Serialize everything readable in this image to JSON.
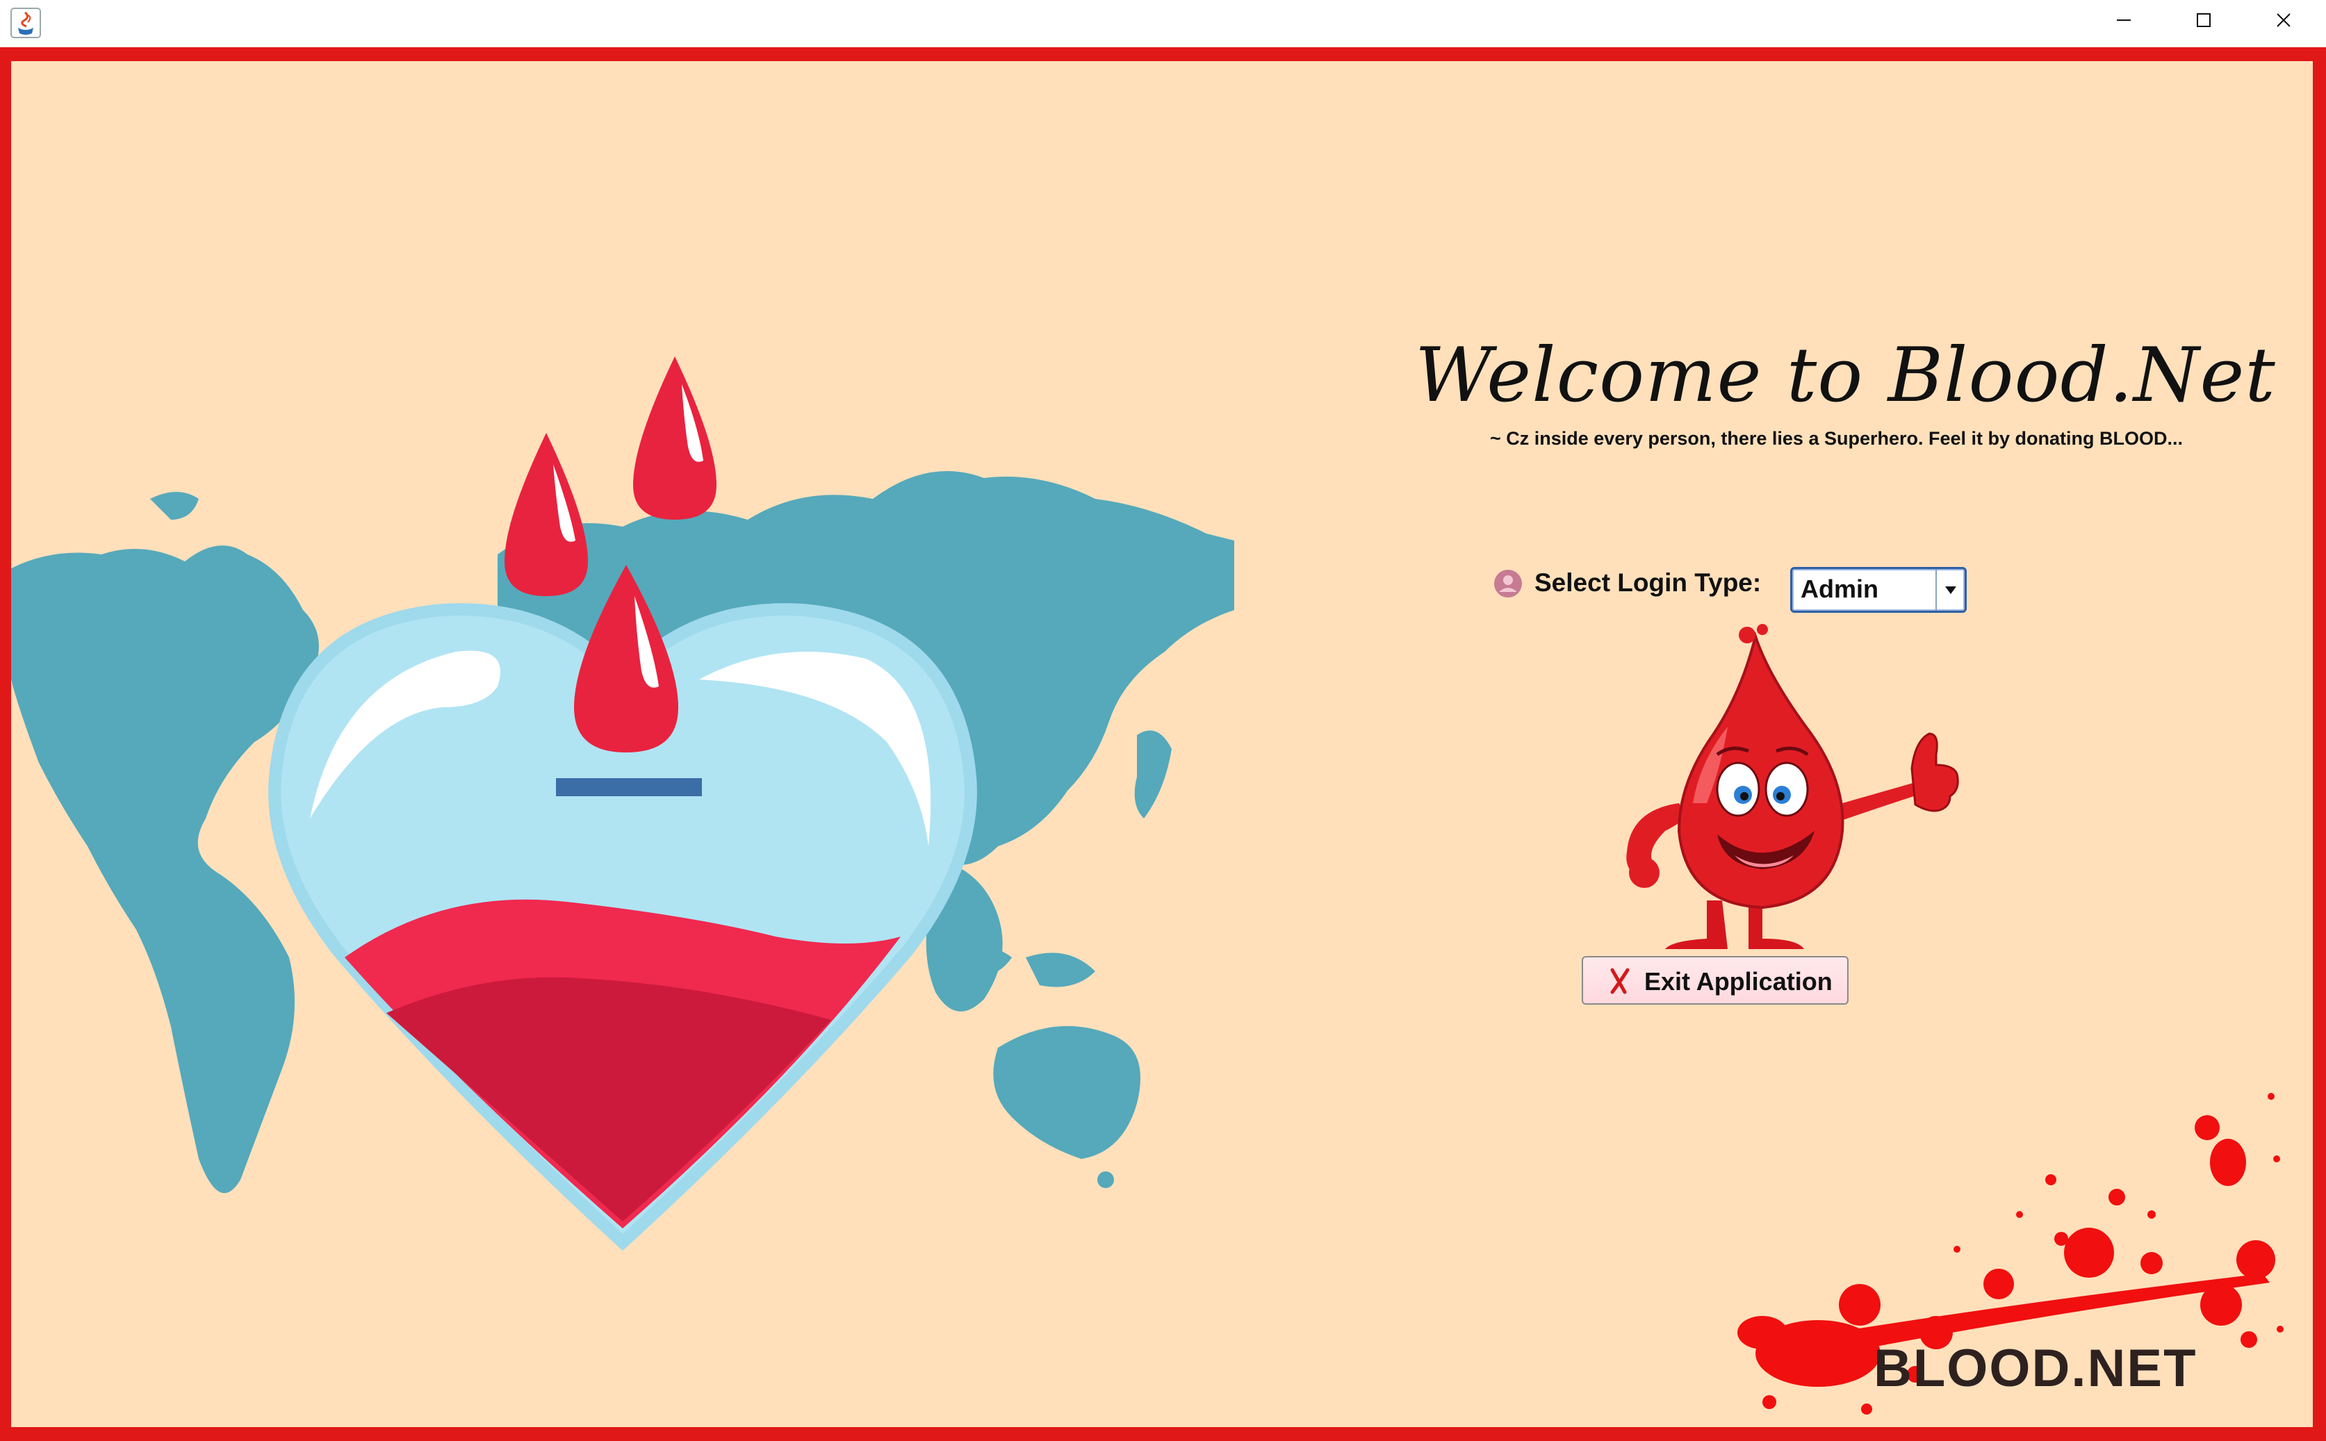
{
  "window": {
    "app_icon": "java-icon",
    "controls": [
      "minimize-icon",
      "maximize-icon",
      "close-icon"
    ]
  },
  "main": {
    "welcome_title": "Welcome to Blood.Net",
    "tagline": "~ Cz inside every person, there lies a Superhero. Feel it by donating BLOOD...",
    "login": {
      "label": "Select Login Type:",
      "selected": "Admin",
      "icon": "user-icon"
    },
    "exit_button": {
      "label": "Exit Application",
      "icon": "x-icon"
    },
    "brand": "BLOOD.NET"
  },
  "colors": {
    "frame_border": "#e01818",
    "background": "#ffe0bb",
    "map": "#55a9bb",
    "heart_glass": "#b0e4f3",
    "blood_light": "#f0294f",
    "blood_dark": "#cc1a3c",
    "mascot_red": "#e11d24"
  }
}
